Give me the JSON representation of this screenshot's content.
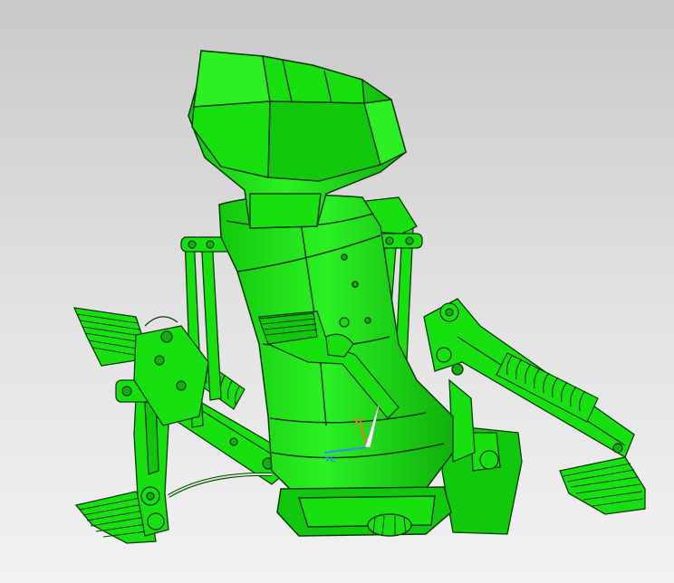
{
  "viewport": {
    "background_top": "#c9c9c9",
    "background_bottom": "#f2f2f2"
  },
  "model": {
    "body_color": "#18e010",
    "edge_color": "#0a3a08",
    "shadow_color": "#0fb00a",
    "highlight_color": "#3cf535",
    "cable_color": "#c8f5c0"
  },
  "triad": {
    "xc_label": "XC",
    "yc_label": "YC",
    "xc_color": "#e07a20",
    "yc_color": "#3a8ee8",
    "zc_color": "#f4f4f4"
  }
}
